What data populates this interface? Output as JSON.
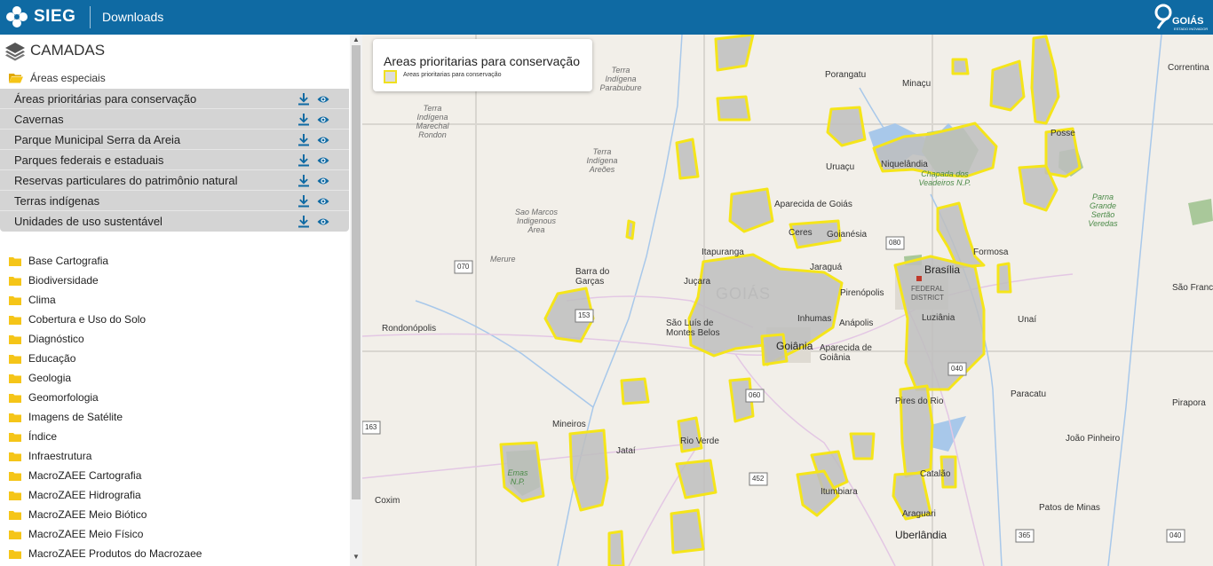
{
  "header": {
    "logo_text": "SIEG",
    "nav_link": "Downloads",
    "right_logo_text": "GOIÁS",
    "right_logo_sub": "ESTADO INOVADOR",
    "bar_color": "#0f6aa3"
  },
  "sidebar": {
    "title": "CAMADAS",
    "special_folder": "Áreas especiais",
    "layers": [
      {
        "label": "Áreas prioritárias para conservação"
      },
      {
        "label": "Cavernas"
      },
      {
        "label": "Parque Municipal Serra da Areia"
      },
      {
        "label": "Parques federais e estaduais"
      },
      {
        "label": "Reservas particulares do patrimônio natural"
      },
      {
        "label": "Terras indígenas"
      },
      {
        "label": "Unidades de uso sustentável"
      }
    ],
    "folders": [
      "Base Cartografia",
      "Biodiversidade",
      "Clima",
      "Cobertura e Uso do Solo",
      "Diagnóstico",
      "Educação",
      "Geologia",
      "Geomorfologia",
      "Imagens de Satélite",
      "Índice",
      "Infraestrutura",
      "MacroZAEE Cartografia",
      "MacroZAEE Hidrografia",
      "MacroZAEE Meio Biótico",
      "MacroZAEE Meio Físico",
      "MacroZAEE Produtos do Macrozaee"
    ],
    "icon_color": "#0f6aa3",
    "folder_color": "#f5c518"
  },
  "legend": {
    "title": "Areas prioritarias para conservação",
    "item": "Areas prioritarias para conservação",
    "outline_color": "#f0e020"
  },
  "map": {
    "labels": {
      "porangatu": "Porangatu",
      "minacu": "Minaçu",
      "corrntina": "Correntina",
      "posse": "Posse",
      "uruacu": "Uruaçu",
      "niquelandia": "Niquelândia",
      "aparecida_goias": "Aparecida de Goiás",
      "ceres": "Ceres",
      "goianesia": "Goianésia",
      "itapuranga": "Itapuranga",
      "jaragua": "Jaraguá",
      "brasilia": "Brasília",
      "formosa": "Formosa",
      "barra_garcas": "Barra do Garças",
      "jucara": "Juçara",
      "goias_region": "GOIÁS",
      "inhumas": "Inhumas",
      "pirenopolis": "Pirenópolis",
      "federal_district": "FEDERAL DISTRICT",
      "luziania": "Luziânia",
      "sao_francisco": "São Franc",
      "unai": "Unaí",
      "rondonopolis": "Rondonópolis",
      "sao_luis": "São Luís de Montes Belos",
      "goiania": "Goiânia",
      "anapolis": "Anápolis",
      "aparecida_goiania": "Aparecida de Goiânia",
      "paracatu": "Paracatu",
      "pirapora": "Pirapora",
      "pires_rio": "Pires do Rio",
      "mineiros": "Mineiros",
      "jatai": "Jataí",
      "rio_verde": "Rio Verde",
      "joao_pinheiro": "João Pinheiro",
      "catalao": "Catalão",
      "itumbiara": "Itumbiara",
      "coxim": "Coxim",
      "araguari": "Araguari",
      "patos_minas": "Patos de Minas",
      "uberlandia": "Uberlândia",
      "ti_parabubure": "Terra Indígena Parabubure",
      "ti_marechal": "Terra Indígena Marechal Rondon",
      "ti_areoes": "Terra Indígena Areões",
      "sao_marcos": "Sao Marcos Indigenous Area",
      "merure": "Merure",
      "chapada": "Chapada dos Veadeiros N.P.",
      "grande_sertao": "Parna Grande Sertão Veredas",
      "emas": "Emas N.P.",
      "road_070": "070",
      "road_080": "080",
      "road_040": "040",
      "road_060": "060",
      "road_153": "153",
      "road_163": "163",
      "road_452": "452",
      "road_365": "365",
      "road_040b": "040"
    }
  }
}
